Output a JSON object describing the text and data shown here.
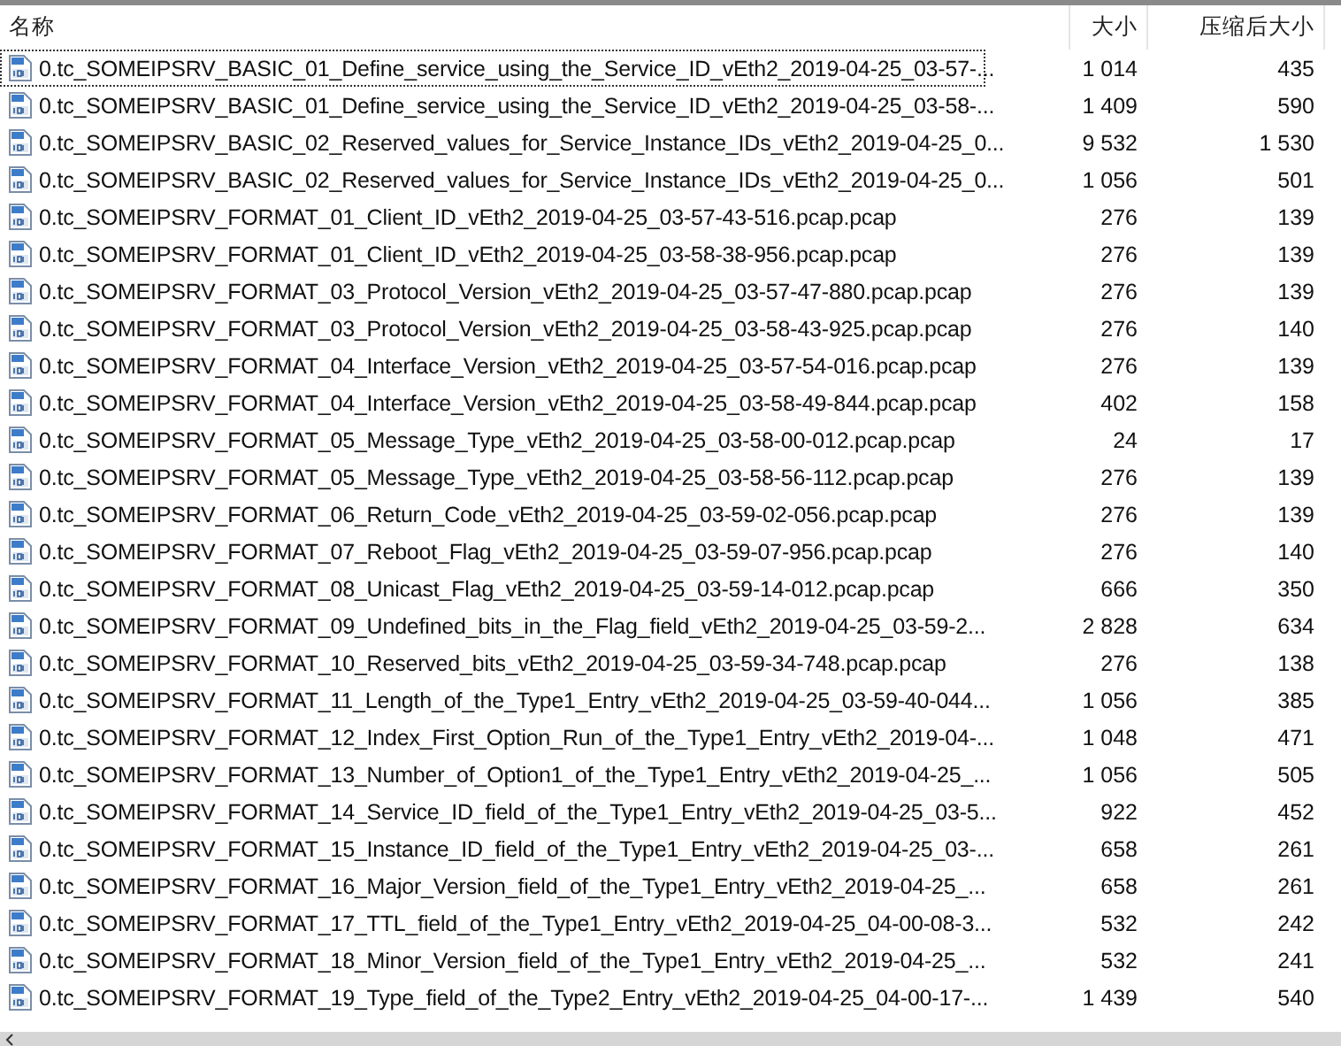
{
  "columns": [
    {
      "label": "名称"
    },
    {
      "label": "大小"
    },
    {
      "label": "压缩后大小"
    }
  ],
  "rows": [
    {
      "name": "0.tc_SOMEIPSRV_BASIC_01_Define_service_using_the_Service_ID_vEth2_2019-04-25_03-57-...",
      "size": "1 014",
      "packed": "435",
      "focused": true
    },
    {
      "name": "0.tc_SOMEIPSRV_BASIC_01_Define_service_using_the_Service_ID_vEth2_2019-04-25_03-58-...",
      "size": "1 409",
      "packed": "590",
      "focused": false
    },
    {
      "name": "0.tc_SOMEIPSRV_BASIC_02_Reserved_values_for_Service_Instance_IDs_vEth2_2019-04-25_0...",
      "size": "9 532",
      "packed": "1 530",
      "focused": false
    },
    {
      "name": "0.tc_SOMEIPSRV_BASIC_02_Reserved_values_for_Service_Instance_IDs_vEth2_2019-04-25_0...",
      "size": "1 056",
      "packed": "501",
      "focused": false
    },
    {
      "name": "0.tc_SOMEIPSRV_FORMAT_01_Client_ID_vEth2_2019-04-25_03-57-43-516.pcap.pcap",
      "size": "276",
      "packed": "139",
      "focused": false
    },
    {
      "name": "0.tc_SOMEIPSRV_FORMAT_01_Client_ID_vEth2_2019-04-25_03-58-38-956.pcap.pcap",
      "size": "276",
      "packed": "139",
      "focused": false
    },
    {
      "name": "0.tc_SOMEIPSRV_FORMAT_03_Protocol_Version_vEth2_2019-04-25_03-57-47-880.pcap.pcap",
      "size": "276",
      "packed": "139",
      "focused": false
    },
    {
      "name": "0.tc_SOMEIPSRV_FORMAT_03_Protocol_Version_vEth2_2019-04-25_03-58-43-925.pcap.pcap",
      "size": "276",
      "packed": "140",
      "focused": false
    },
    {
      "name": "0.tc_SOMEIPSRV_FORMAT_04_Interface_Version_vEth2_2019-04-25_03-57-54-016.pcap.pcap",
      "size": "276",
      "packed": "139",
      "focused": false
    },
    {
      "name": "0.tc_SOMEIPSRV_FORMAT_04_Interface_Version_vEth2_2019-04-25_03-58-49-844.pcap.pcap",
      "size": "402",
      "packed": "158",
      "focused": false
    },
    {
      "name": "0.tc_SOMEIPSRV_FORMAT_05_Message_Type_vEth2_2019-04-25_03-58-00-012.pcap.pcap",
      "size": "24",
      "packed": "17",
      "focused": false
    },
    {
      "name": "0.tc_SOMEIPSRV_FORMAT_05_Message_Type_vEth2_2019-04-25_03-58-56-112.pcap.pcap",
      "size": "276",
      "packed": "139",
      "focused": false
    },
    {
      "name": "0.tc_SOMEIPSRV_FORMAT_06_Return_Code_vEth2_2019-04-25_03-59-02-056.pcap.pcap",
      "size": "276",
      "packed": "139",
      "focused": false
    },
    {
      "name": "0.tc_SOMEIPSRV_FORMAT_07_Reboot_Flag_vEth2_2019-04-25_03-59-07-956.pcap.pcap",
      "size": "276",
      "packed": "140",
      "focused": false
    },
    {
      "name": "0.tc_SOMEIPSRV_FORMAT_08_Unicast_Flag_vEth2_2019-04-25_03-59-14-012.pcap.pcap",
      "size": "666",
      "packed": "350",
      "focused": false
    },
    {
      "name": "0.tc_SOMEIPSRV_FORMAT_09_Undefined_bits_in_the_Flag_field_vEth2_2019-04-25_03-59-2...",
      "size": "2 828",
      "packed": "634",
      "focused": false
    },
    {
      "name": "0.tc_SOMEIPSRV_FORMAT_10_Reserved_bits_vEth2_2019-04-25_03-59-34-748.pcap.pcap",
      "size": "276",
      "packed": "138",
      "focused": false
    },
    {
      "name": "0.tc_SOMEIPSRV_FORMAT_11_Length_of_the_Type1_Entry_vEth2_2019-04-25_03-59-40-044...",
      "size": "1 056",
      "packed": "385",
      "focused": false
    },
    {
      "name": "0.tc_SOMEIPSRV_FORMAT_12_Index_First_Option_Run_of_the_Type1_Entry_vEth2_2019-04-...",
      "size": "1 048",
      "packed": "471",
      "focused": false
    },
    {
      "name": "0.tc_SOMEIPSRV_FORMAT_13_Number_of_Option1_of_the_Type1_Entry_vEth2_2019-04-25_...",
      "size": "1 056",
      "packed": "505",
      "focused": false
    },
    {
      "name": "0.tc_SOMEIPSRV_FORMAT_14_Service_ID_field_of_the_Type1_Entry_vEth2_2019-04-25_03-5...",
      "size": "922",
      "packed": "452",
      "focused": false
    },
    {
      "name": "0.tc_SOMEIPSRV_FORMAT_15_Instance_ID_field_of_the_Type1_Entry_vEth2_2019-04-25_03-...",
      "size": "658",
      "packed": "261",
      "focused": false
    },
    {
      "name": "0.tc_SOMEIPSRV_FORMAT_16_Major_Version_field_of_the_Type1_Entry_vEth2_2019-04-25_...",
      "size": "658",
      "packed": "261",
      "focused": false
    },
    {
      "name": "0.tc_SOMEIPSRV_FORMAT_17_TTL_field_of_the_Type1_Entry_vEth2_2019-04-25_04-00-08-3...",
      "size": "532",
      "packed": "242",
      "focused": false
    },
    {
      "name": "0.tc_SOMEIPSRV_FORMAT_18_Minor_Version_field_of_the_Type1_Entry_vEth2_2019-04-25_...",
      "size": "532",
      "packed": "241",
      "focused": false
    },
    {
      "name": "0.tc_SOMEIPSRV_FORMAT_19_Type_field_of_the_Type2_Entry_vEth2_2019-04-25_04-00-17-...",
      "size": "1 439",
      "packed": "540",
      "focused": false
    }
  ]
}
